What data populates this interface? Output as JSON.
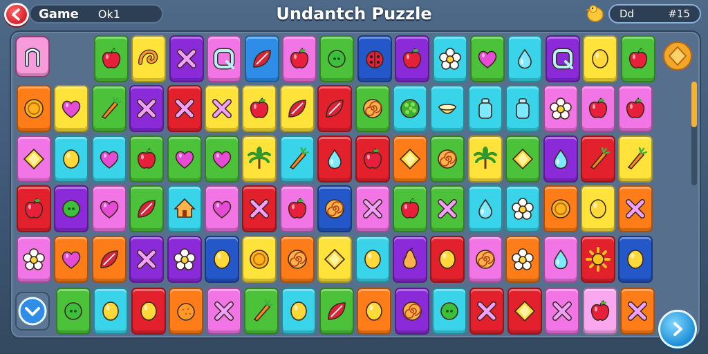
{
  "header": {
    "back_icon": "back-arrow-icon",
    "game_label": "Game",
    "game_value": "Ok1",
    "title": "Undantch Puzzle",
    "mascot_icon": "chick-icon",
    "score_label": "Dd",
    "score_value": "#15"
  },
  "side": {
    "top_left_icon": "n-tile-icon",
    "bottom_left_icon": "chevron-down-icon",
    "top_right_icon": "diamond-badge-icon",
    "next_icon": "chevron-right-icon",
    "scroll_position": 0.0
  },
  "colors": {
    "green": "#4cc23a",
    "yellow": "#ffe23a",
    "purple": "#8a2ad8",
    "pink": "#f275e6",
    "blue": "#2f8de8",
    "cyan": "#3ad4ea",
    "red": "#e3212c",
    "orange": "#ff7d18",
    "lime": "#b5e83a",
    "navy": "#2457c8",
    "magenta": "#d53ad8",
    "lightpink": "#f9a8f0"
  },
  "board": {
    "rows": [
      [
        {
          "bg": "green",
          "icon": "apple"
        },
        {
          "bg": "yellow",
          "icon": "swirl"
        },
        {
          "bg": "purple",
          "icon": "x"
        },
        {
          "bg": "pink",
          "icon": "q"
        },
        {
          "bg": "blue",
          "icon": "leaf"
        },
        {
          "bg": "pink",
          "icon": "apple"
        },
        {
          "bg": "green",
          "icon": "circle"
        },
        {
          "bg": "navy",
          "icon": "ladybug"
        },
        {
          "bg": "purple",
          "icon": "apple"
        },
        {
          "bg": "cyan",
          "icon": "flower"
        },
        {
          "bg": "green",
          "icon": "heart"
        },
        {
          "bg": "cyan",
          "icon": "drop"
        },
        {
          "bg": "purple",
          "icon": "q"
        },
        {
          "bg": "yellow",
          "icon": "lemon"
        },
        {
          "bg": "green",
          "icon": "apple"
        }
      ],
      [
        {
          "bg": "orange",
          "icon": "coin"
        },
        {
          "bg": "yellow",
          "icon": "heart"
        },
        {
          "bg": "green",
          "icon": "carrot"
        },
        {
          "bg": "purple",
          "icon": "x"
        },
        {
          "bg": "red",
          "icon": "x"
        },
        {
          "bg": "yellow",
          "icon": "x"
        },
        {
          "bg": "yellow",
          "icon": "apple"
        },
        {
          "bg": "yellow",
          "icon": "leaf"
        },
        {
          "bg": "red",
          "icon": "leaf"
        },
        {
          "bg": "green",
          "icon": "spiral"
        },
        {
          "bg": "cyan",
          "icon": "bush"
        },
        {
          "bg": "cyan",
          "icon": "bowl"
        },
        {
          "bg": "cyan",
          "icon": "bottle"
        },
        {
          "bg": "cyan",
          "icon": "bottle"
        },
        {
          "bg": "pink",
          "icon": "flower"
        },
        {
          "bg": "pink",
          "icon": "apple"
        },
        {
          "bg": "pink",
          "icon": "apple"
        }
      ],
      [
        {
          "bg": "pink",
          "icon": "diamond"
        },
        {
          "bg": "cyan",
          "icon": "lemon"
        },
        {
          "bg": "cyan",
          "icon": "heart"
        },
        {
          "bg": "green",
          "icon": "apple"
        },
        {
          "bg": "green",
          "icon": "heart"
        },
        {
          "bg": "green",
          "icon": "heart"
        },
        {
          "bg": "yellow",
          "icon": "palm"
        },
        {
          "bg": "cyan",
          "icon": "carrot"
        },
        {
          "bg": "red",
          "icon": "drop"
        },
        {
          "bg": "red",
          "icon": "apple"
        },
        {
          "bg": "orange",
          "icon": "diamond"
        },
        {
          "bg": "green",
          "icon": "spiral"
        },
        {
          "bg": "yellow",
          "icon": "palm"
        },
        {
          "bg": "green",
          "icon": "diamond"
        },
        {
          "bg": "purple",
          "icon": "drop"
        },
        {
          "bg": "red",
          "icon": "carrot"
        },
        {
          "bg": "yellow",
          "icon": "carrot"
        }
      ],
      [
        {
          "bg": "red",
          "icon": "apple"
        },
        {
          "bg": "purple",
          "icon": "circle"
        },
        {
          "bg": "pink",
          "icon": "heart"
        },
        {
          "bg": "green",
          "icon": "leaf"
        },
        {
          "bg": "cyan",
          "icon": "house"
        },
        {
          "bg": "pink",
          "icon": "heart"
        },
        {
          "bg": "red",
          "icon": "x"
        },
        {
          "bg": "pink",
          "icon": "apple"
        },
        {
          "bg": "navy",
          "icon": "spiral"
        },
        {
          "bg": "pink",
          "icon": "x"
        },
        {
          "bg": "green",
          "icon": "apple"
        },
        {
          "bg": "green",
          "icon": "x"
        },
        {
          "bg": "cyan",
          "icon": "drop"
        },
        {
          "bg": "cyan",
          "icon": "flower"
        },
        {
          "bg": "orange",
          "icon": "coin"
        },
        {
          "bg": "yellow",
          "icon": "lemon"
        },
        {
          "bg": "orange",
          "icon": "x"
        }
      ],
      [
        {
          "bg": "pink",
          "icon": "flower"
        },
        {
          "bg": "orange",
          "icon": "heart"
        },
        {
          "bg": "orange",
          "icon": "leaf"
        },
        {
          "bg": "purple",
          "icon": "x"
        },
        {
          "bg": "purple",
          "icon": "flower"
        },
        {
          "bg": "navy",
          "icon": "lemon"
        },
        {
          "bg": "yellow",
          "icon": "coin"
        },
        {
          "bg": "orange",
          "icon": "spiral"
        },
        {
          "bg": "yellow",
          "icon": "diamond"
        },
        {
          "bg": "cyan",
          "icon": "lemon"
        },
        {
          "bg": "purple",
          "icon": "pear"
        },
        {
          "bg": "red",
          "icon": "lemon"
        },
        {
          "bg": "pink",
          "icon": "spiral"
        },
        {
          "bg": "orange",
          "icon": "flower"
        },
        {
          "bg": "pink",
          "icon": "drop"
        },
        {
          "bg": "red",
          "icon": "sun"
        },
        {
          "bg": "navy",
          "icon": "lemon"
        }
      ],
      [
        {
          "bg": "green",
          "icon": "circle"
        },
        {
          "bg": "cyan",
          "icon": "lemon"
        },
        {
          "bg": "red",
          "icon": "lemon"
        },
        {
          "bg": "orange",
          "icon": "orange"
        },
        {
          "bg": "pink",
          "icon": "x"
        },
        {
          "bg": "green",
          "icon": "carrot"
        },
        {
          "bg": "cyan",
          "icon": "lemon"
        },
        {
          "bg": "green",
          "icon": "leaf"
        },
        {
          "bg": "orange",
          "icon": "lemon"
        },
        {
          "bg": "purple",
          "icon": "spiral"
        },
        {
          "bg": "cyan",
          "icon": "circle"
        },
        {
          "bg": "red",
          "icon": "x"
        },
        {
          "bg": "red",
          "icon": "diamond"
        },
        {
          "bg": "pink",
          "icon": "x"
        },
        {
          "bg": "lightpink",
          "icon": "apple"
        },
        {
          "bg": "orange",
          "icon": "x"
        }
      ]
    ]
  }
}
